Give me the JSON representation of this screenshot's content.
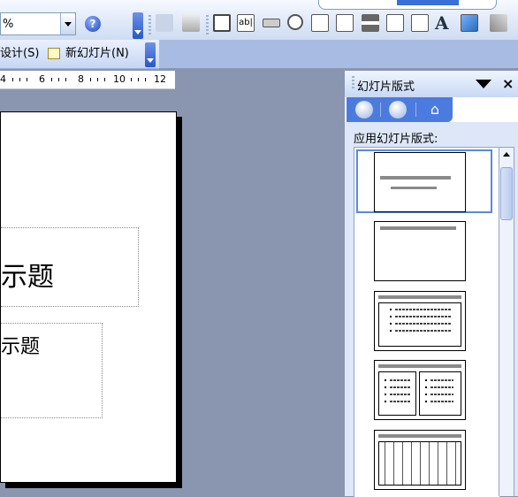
{
  "toolbar": {
    "zoom_value": "%",
    "help_symbol": "?"
  },
  "toolbar2": {
    "design_label": "设计(S)",
    "new_slide_label": "新幻灯片(N)"
  },
  "ruler": {
    "numbers": [
      "4",
      "6",
      "8",
      "10",
      "12"
    ]
  },
  "slide": {
    "title_placeholder": "示题",
    "subtitle_placeholder": "示题"
  },
  "task_pane": {
    "title": "幻灯片版式",
    "close_symbol": "×",
    "section_label": "应用幻灯片版式:",
    "layouts": [
      "title-slide",
      "title-only",
      "title-and-text",
      "title-and-two-column-text",
      "title-and-vertical-text"
    ]
  },
  "icons": {
    "home": "home-icon"
  }
}
